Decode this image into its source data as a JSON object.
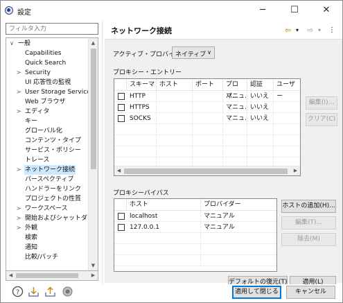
{
  "window": {
    "title": "設定",
    "minimize": "─",
    "maximize": "☐",
    "close": "✕"
  },
  "filter": {
    "placeholder": "フィルタ入力"
  },
  "tree": {
    "items": [
      {
        "label": "一般",
        "indent": 0,
        "arrow": "∨"
      },
      {
        "label": "Capabilities",
        "indent": 1,
        "arrow": ""
      },
      {
        "label": "Quick Search",
        "indent": 1,
        "arrow": ""
      },
      {
        "label": "Security",
        "indent": 1,
        "arrow": ">"
      },
      {
        "label": "UI 応答性の監視",
        "indent": 1,
        "arrow": ""
      },
      {
        "label": "User Storage Service",
        "indent": 1,
        "arrow": ">"
      },
      {
        "label": "Web ブラウザ",
        "indent": 1,
        "arrow": ""
      },
      {
        "label": "エディタ",
        "indent": 1,
        "arrow": ">"
      },
      {
        "label": "キー",
        "indent": 1,
        "arrow": ""
      },
      {
        "label": "グローバル化",
        "indent": 1,
        "arrow": ""
      },
      {
        "label": "コンテンツ・タイプ",
        "indent": 1,
        "arrow": ""
      },
      {
        "label": "サービス・ポリシー",
        "indent": 1,
        "arrow": ""
      },
      {
        "label": "トレース",
        "indent": 1,
        "arrow": ""
      },
      {
        "label": "ネットワーク接続",
        "indent": 1,
        "arrow": ">",
        "selected": true
      },
      {
        "label": "パースペクティブ",
        "indent": 1,
        "arrow": ""
      },
      {
        "label": "ハンドラーをリンク",
        "indent": 1,
        "arrow": ""
      },
      {
        "label": "プロジェクトの性質",
        "indent": 1,
        "arrow": ""
      },
      {
        "label": "ワークスペース",
        "indent": 1,
        "arrow": ">"
      },
      {
        "label": "開始およびシャットダウン",
        "indent": 1,
        "arrow": ">"
      },
      {
        "label": "外観",
        "indent": 1,
        "arrow": ">"
      },
      {
        "label": "検索",
        "indent": 1,
        "arrow": ""
      },
      {
        "label": "通知",
        "indent": 1,
        "arrow": ""
      },
      {
        "label": "比較/パッチ",
        "indent": 1,
        "arrow": ""
      }
    ]
  },
  "page": {
    "title": "ネットワーク接続",
    "active_provider_label": "アクティブ・プロバイダー:",
    "active_provider_value": "ネイティブ",
    "proxy_entries_label": "プロキシー・エントリー",
    "proxy_columns": [
      "スキーマ",
      "ホスト",
      "ポート",
      "プロバ...",
      "認証",
      "ユーザー"
    ],
    "proxy_rows": [
      {
        "scheme": "HTTP",
        "host": "",
        "port": "",
        "provider": "マニュ...",
        "auth": "いいえ",
        "user": ""
      },
      {
        "scheme": "HTTPS",
        "host": "",
        "port": "",
        "provider": "マニュ...",
        "auth": "いいえ",
        "user": ""
      },
      {
        "scheme": "SOCKS",
        "host": "",
        "port": "",
        "provider": "マニュ...",
        "auth": "いいえ",
        "user": ""
      }
    ],
    "edit_button": "編集(I)...",
    "clear_button": "クリア(C)",
    "bypass_label": "プロキシーバイパス",
    "bypass_columns": [
      "ホスト",
      "プロバイダー"
    ],
    "bypass_rows": [
      {
        "host": "localhost",
        "provider": "マニュアル"
      },
      {
        "host": "127.0.0.1",
        "provider": "マニュアル"
      }
    ],
    "add_host_button": "ホストの追加(H)...",
    "bypass_edit_button": "編集(T)...",
    "remove_button": "除去(M)",
    "restore_defaults_button": "デフォルトの復元(T)",
    "apply_button": "適用(L)"
  },
  "footer": {
    "apply_close_button": "適用して閉じる",
    "cancel_button": "キャンセル"
  },
  "colors": {
    "accent": "#0078d7",
    "selection": "#cce8ff"
  }
}
